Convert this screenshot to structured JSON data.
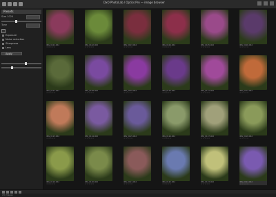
{
  "window": {
    "title": "DxO PhotoLab / Optics Pro — image browser"
  },
  "sidebar": {
    "header": "Presets",
    "rows": [
      {
        "label": "Size 1024"
      },
      {
        "label": "Tone"
      }
    ],
    "items": [
      {
        "label": "Exposure"
      },
      {
        "label": "Noise reduction"
      },
      {
        "label": "Sharpness"
      },
      {
        "label": "Lens"
      }
    ],
    "apply_label": "Apply"
  },
  "thumbnails": [
    {
      "color": "#8a3a5c",
      "caption": "IMG_0101.CR2"
    },
    {
      "color": "#6b8a3a",
      "caption": "IMG_0102.CR2"
    },
    {
      "color": "#7a2e3e",
      "caption": "IMG_0103.CR2"
    },
    {
      "color": "#8c2f4a",
      "caption": "IMG_0104.CR2"
    },
    {
      "color": "#9a4a8a",
      "caption": "IMG_0105.CR2"
    },
    {
      "color": "#5a3a6a",
      "caption": "IMG_0106.CR2"
    },
    {
      "color": "#5a6a3a",
      "caption": "IMG_0107.CR2"
    },
    {
      "color": "#7a4aa0",
      "caption": "IMG_0108.CR2"
    },
    {
      "color": "#8a3aa0",
      "caption": "IMG_0109.CR2"
    },
    {
      "color": "#6a3a8a",
      "caption": "IMG_0110.CR2"
    },
    {
      "color": "#a04a9a",
      "caption": "IMG_0111.CR2"
    },
    {
      "color": "#c06a3a",
      "caption": "IMG_0112.CR2"
    },
    {
      "color": "#c07a5a",
      "caption": "IMG_0113.CR2"
    },
    {
      "color": "#7a5aa0",
      "caption": "IMG_0114.CR2"
    },
    {
      "color": "#6a5a9a",
      "caption": "IMG_0115.CR2"
    },
    {
      "color": "#8a9a6a",
      "caption": "IMG_0116.CR2"
    },
    {
      "color": "#a0a07a",
      "caption": "IMG_0117.CR2"
    },
    {
      "color": "#8a9a5a",
      "caption": "IMG_0118.CR2"
    },
    {
      "color": "#8a9a4a",
      "caption": "IMG_0119.CR2"
    },
    {
      "color": "#7a8a4a",
      "caption": "IMG_0120.CR2"
    },
    {
      "color": "#8a5a5a",
      "caption": "IMG_0121.CR2"
    },
    {
      "color": "#6a7ab0",
      "caption": "IMG_0122.CR2"
    },
    {
      "color": "#c0c07a",
      "caption": "IMG_0123.CR2"
    },
    {
      "color": "#7a5ab0",
      "caption": "IMG_0124.CR2"
    }
  ],
  "status": "24 images"
}
